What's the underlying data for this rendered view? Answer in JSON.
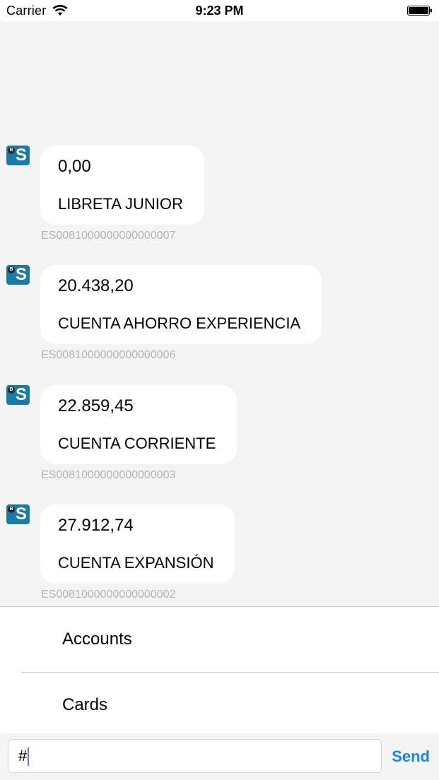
{
  "status_bar": {
    "carrier": "Carrier",
    "time": "9:23 PM",
    "wifi_icon": "wifi-icon",
    "battery_icon": "battery-icon"
  },
  "avatar": {
    "letter": "S",
    "badge": "B",
    "color": "#1b7aa8"
  },
  "messages": [
    {
      "amount": "0,00",
      "name": "LIBRETA JUNIOR",
      "iban": "ES0081000000000000007"
    },
    {
      "amount": "20.438,20",
      "name": "CUENTA AHORRO EXPERIENCIA",
      "iban": "ES0081000000000000006"
    },
    {
      "amount": "22.859,45",
      "name": "CUENTA CORRIENTE",
      "iban": "ES0081000000000000003"
    },
    {
      "amount": "27.912,74",
      "name": "CUENTA EXPANSIÓN",
      "iban": "ES0081000000000000002"
    }
  ],
  "quick_replies": [
    {
      "label": "Accounts"
    },
    {
      "label": "Cards"
    }
  ],
  "input": {
    "value": "#",
    "placeholder": ""
  },
  "send_label": "Send",
  "colors": {
    "accent": "#1a82f0",
    "background": "#f4f4f4",
    "iban_text": "#b3b3b3"
  }
}
